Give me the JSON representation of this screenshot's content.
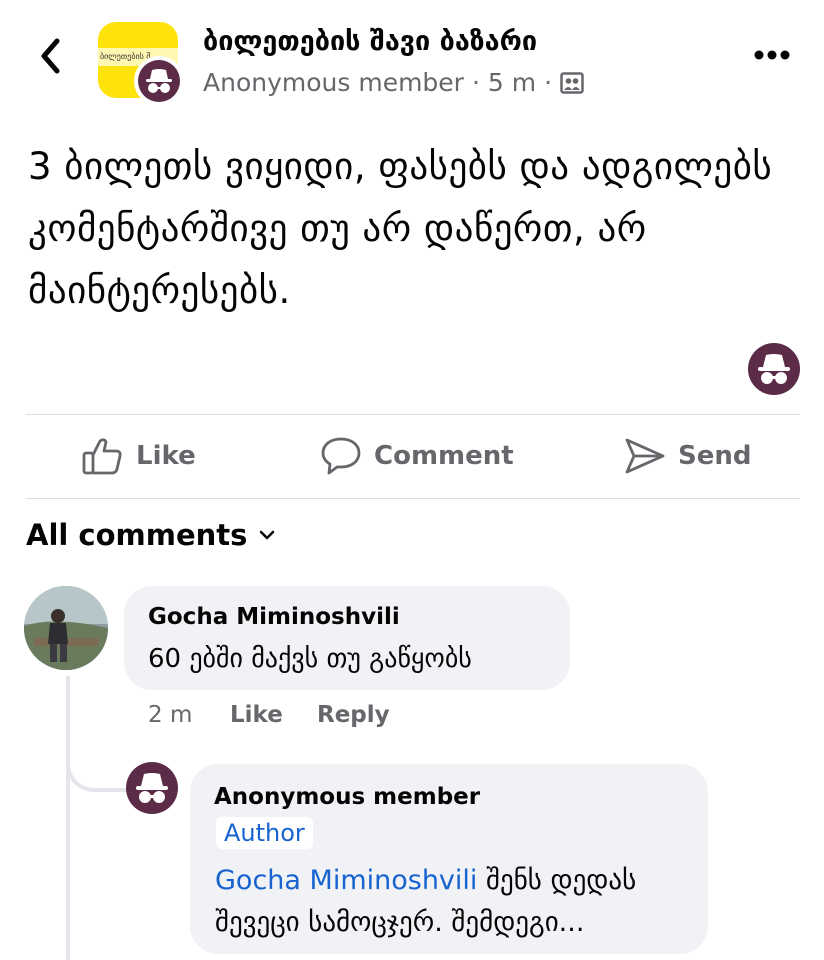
{
  "header": {
    "group_name": "ბილეთების შავი ბაზარი",
    "group_avatar_text": "ბილეთების შ...",
    "poster": "Anonymous member",
    "separator": "·",
    "time": "5 m",
    "separator2": "·"
  },
  "post": {
    "text": "3 ბილეთს ვიყიდი, ფასებს და ადგილებს კომენტარშივე თუ არ დაწერთ, არ მაინტერესებს."
  },
  "actions": {
    "like": "Like",
    "comment": "Comment",
    "send": "Send"
  },
  "comments_section": {
    "filter_label": "All comments",
    "comments": [
      {
        "author": "Gocha Miminoshvili",
        "text": "60 ებში მაქვს თუ გაწყობს",
        "time": "2 m",
        "like": "Like",
        "reply": "Reply"
      }
    ],
    "reply": {
      "author": "Anonymous member",
      "badge": "Author",
      "mention": "Gocha Miminoshvili",
      "text": " შენს დედას შევეცი სამოცჯერ. შემდეგი..."
    }
  },
  "colors": {
    "anon_avatar": "#5b2b47",
    "group_avatar": "#fde20b",
    "link": "#1763cf",
    "muted": "#65676b",
    "bubble": "#f0f2f5"
  }
}
